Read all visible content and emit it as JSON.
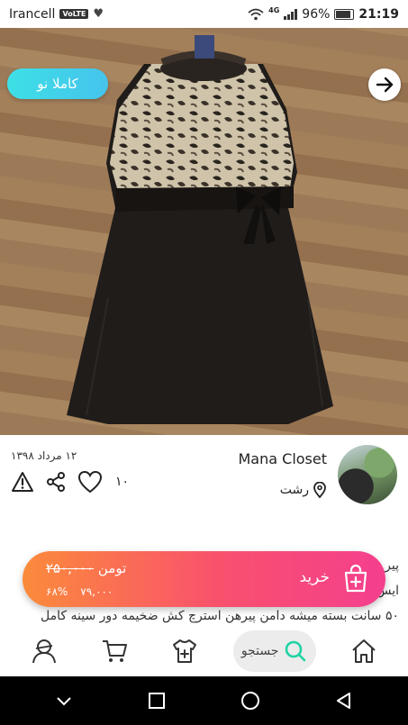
{
  "status_bar": {
    "carrier": "Irancell",
    "volte": "VoLTE",
    "network": "4G",
    "battery": "96%",
    "time": "21:19"
  },
  "product": {
    "condition_badge": "کاملا نو",
    "image_count": 2,
    "active_image": 1,
    "date": "۱۲ مرداد ۱۳۹۸",
    "likes": "۱۰"
  },
  "seller": {
    "name": "Mana Closet",
    "city": "رشت"
  },
  "description": {
    "lines": [
      "پیر",
      "ایس",
      "۵۰ سانت بسته میشه دامن پیرهن استرچ کش ضخیمه دور سینه کامل"
    ]
  },
  "buy_bar": {
    "old_price": "۲۵۰,۰۰۰",
    "currency": "تومن",
    "discount": "۶۸%",
    "new_price": "۷۹,۰۰۰",
    "button_label": "خرید"
  },
  "bottom_nav": {
    "search_label": "جستجو"
  },
  "colors": {
    "badge": "#3de0e6",
    "buy_gradient_start": "#fb8b3b",
    "buy_gradient_end": "#f43f8e",
    "search_accent": "#1fd3a4"
  }
}
